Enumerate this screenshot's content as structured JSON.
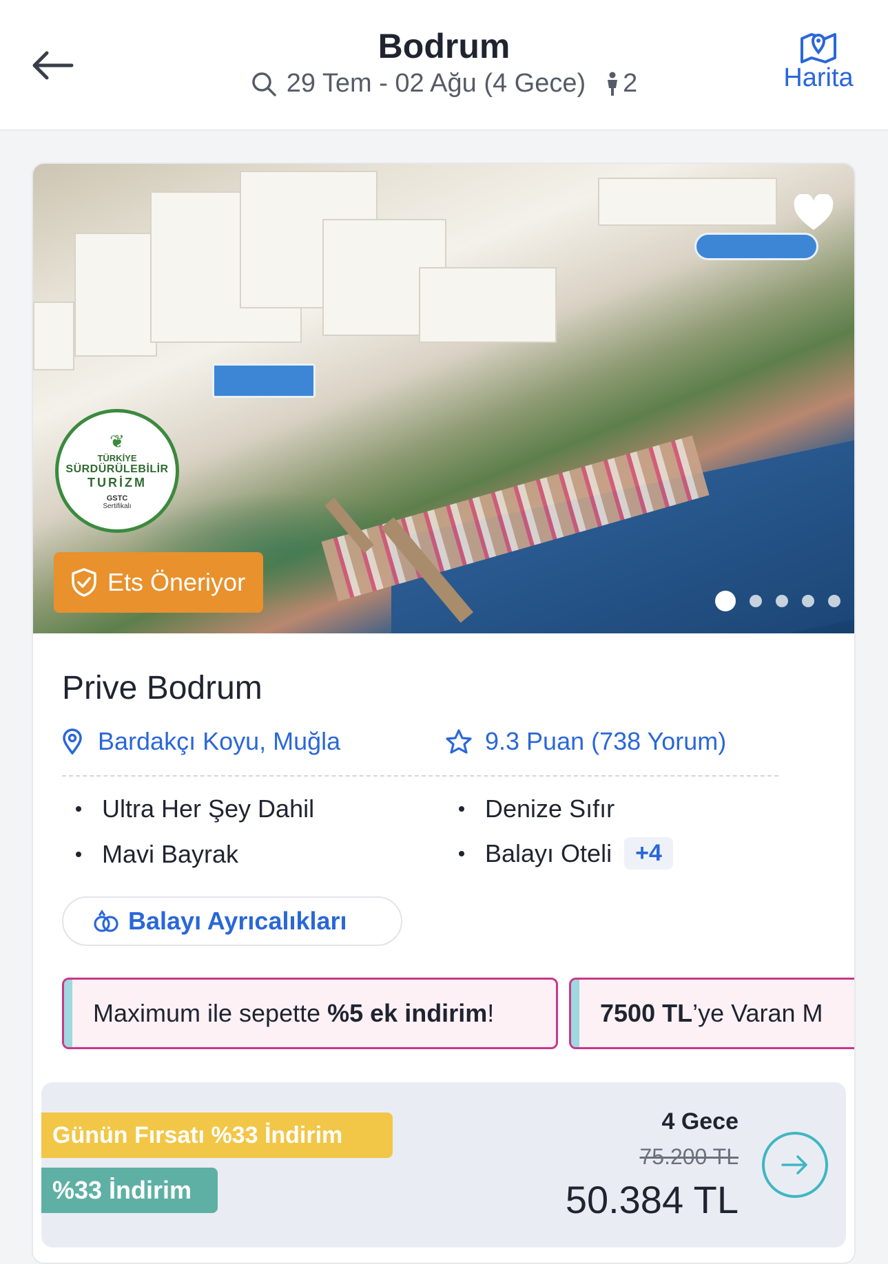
{
  "header": {
    "title": "Bodrum",
    "dates": "29 Tem - 02 Ağu (4 Gece)",
    "guests": "2",
    "map_label": "Harita",
    "icons": {
      "back": "arrow-left-icon",
      "search": "search-icon",
      "person": "person-icon",
      "map": "map-pin-icon"
    }
  },
  "hotel": {
    "photo": {
      "sustainability_badge": {
        "line1": "TÜRKİYE",
        "line2": "SÜRDÜRÜLEBİLİR",
        "line3": "TURİZM",
        "line4": "GSTC",
        "line5": "Sertifikalı"
      },
      "recommend_label": "Ets Öneriyor",
      "slide_count": 5,
      "active_slide": 1
    },
    "name": "Prive Bodrum",
    "location": "Bardakçı Koyu, Muğla",
    "rating": "9.3 Puan (738 Yorum)",
    "features": [
      "Ultra Her Şey Dahil",
      "Denize Sıfır",
      "Mavi Bayrak",
      "Balayı Oteli"
    ],
    "more_features": "+4",
    "honeymoon_button": "Balayı Ayrıcalıkları",
    "promos": [
      {
        "pre": "Maximum ile sepette ",
        "bold": "%5 ek indirim",
        "post": "!"
      },
      {
        "pre": "",
        "bold": "7500 TL",
        "post": "’ye Varan M"
      }
    ],
    "price": {
      "deal_label": "Günün Fırsatı %33 İndirim",
      "discount_label": "%33 İndirim",
      "nights": "4 Gece",
      "old_price": "75.200 TL",
      "new_price": "50.384 TL"
    }
  },
  "colors": {
    "accent_blue": "#2a67d8",
    "recommend_orange": "#e8912d",
    "deal_yellow": "#f2c646",
    "discount_teal": "#5fb0a4",
    "promo_border": "#c7388a",
    "go_button": "#3fb6c2"
  }
}
